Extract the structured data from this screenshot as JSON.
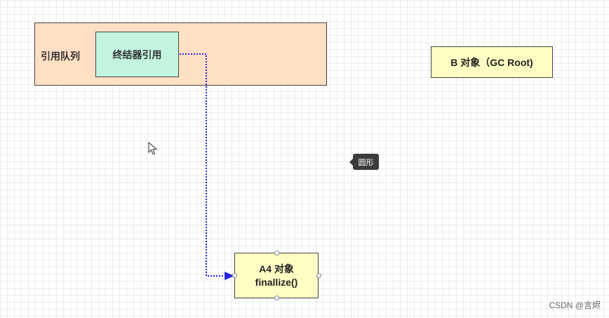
{
  "diagram": {
    "queue_label": "引用队列",
    "finalizer_label": "终结器引用",
    "b_object_label": "B 对象（GC Root)",
    "a4_object": {
      "line1": "A4 对象",
      "line2": "finallize()"
    },
    "tooltip": "圆形",
    "watermark": "CSDN @言烬",
    "colors": {
      "queue_fill": "#ffe0c4",
      "finalizer_fill": "#c3f4e0",
      "object_fill": "#fffdc4",
      "connector": "#2424d8"
    }
  }
}
